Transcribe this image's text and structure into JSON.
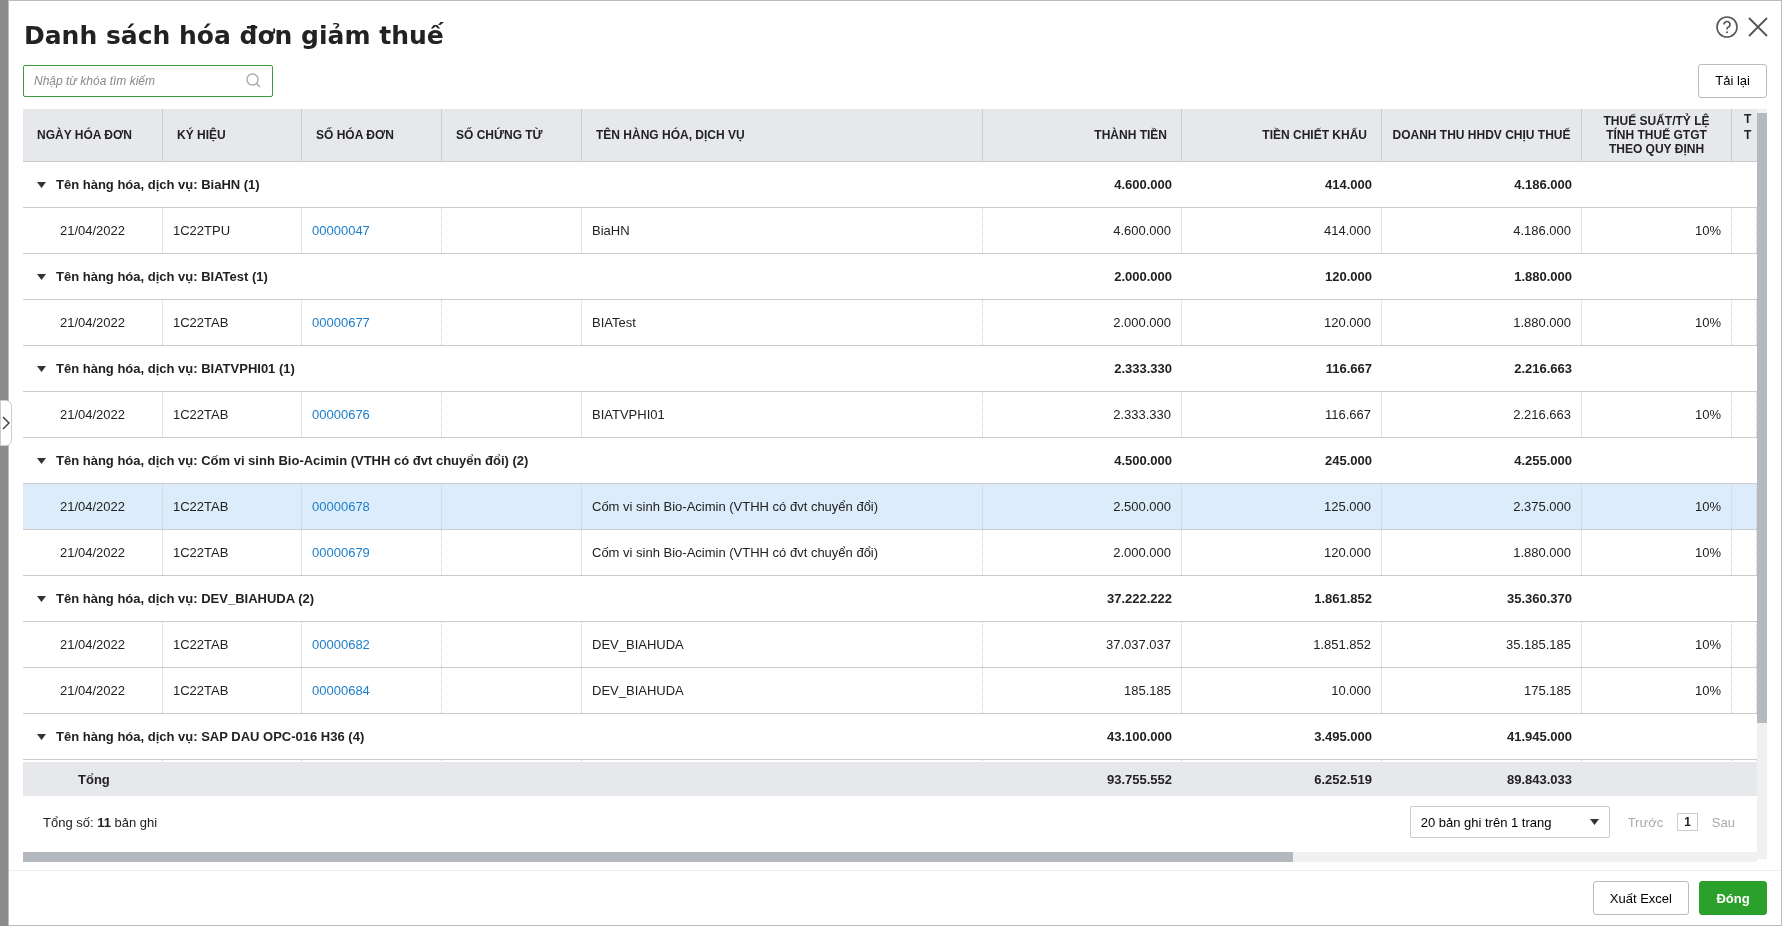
{
  "dialog": {
    "title": "Danh sách hóa đơn giảm thuế"
  },
  "search": {
    "placeholder": "Nhập từ khóa tìm kiếm"
  },
  "reload_button": "Tải lại",
  "table": {
    "columns": [
      "NGÀY HÓA ĐƠN",
      "KÝ HIỆU",
      "SỐ HÓA ĐƠN",
      "SỐ CHỨNG TỪ",
      "TÊN HÀNG HÓA, DỊCH VỤ",
      "THÀNH TIỀN",
      "TIỀN CHIẾT KHẤU",
      "DOANH THU HHDV CHỊU THUẾ",
      "THUẾ SUẤT/TỶ LỆ TÍNH THUẾ GTGT THEO QUY ĐỊNH",
      "T T"
    ],
    "groups": [
      {
        "label": "Tên hàng hóa, dịch vụ: BiaHN (1)",
        "expanded": true,
        "amount": "4.600.000",
        "discount": "414.000",
        "revenue": "4.186.000",
        "rows": [
          {
            "date": "21/04/2022",
            "symbol": "1C22TPU",
            "number": "00000047",
            "name": "BiaHN",
            "amount": "4.600.000",
            "discount": "414.000",
            "revenue": "4.186.000",
            "rate": "10%",
            "selected": false
          }
        ]
      },
      {
        "label": "Tên hàng hóa, dịch vụ: BIATest (1)",
        "expanded": true,
        "amount": "2.000.000",
        "discount": "120.000",
        "revenue": "1.880.000",
        "rows": [
          {
            "date": "21/04/2022",
            "symbol": "1C22TAB",
            "number": "00000677",
            "name": "BIATest",
            "amount": "2.000.000",
            "discount": "120.000",
            "revenue": "1.880.000",
            "rate": "10%",
            "selected": false
          }
        ]
      },
      {
        "label": "Tên hàng hóa, dịch vụ: BIATVPHI01 (1)",
        "expanded": true,
        "amount": "2.333.330",
        "discount": "116.667",
        "revenue": "2.216.663",
        "rows": [
          {
            "date": "21/04/2022",
            "symbol": "1C22TAB",
            "number": "00000676",
            "name": "BIATVPHI01",
            "amount": "2.333.330",
            "discount": "116.667",
            "revenue": "2.216.663",
            "rate": "10%",
            "selected": false
          }
        ]
      },
      {
        "label": "Tên hàng hóa, dịch vụ: Cốm vi sinh Bio-Acimin (VTHH có đvt chuyển đổi) (2)",
        "expanded": true,
        "amount": "4.500.000",
        "discount": "245.000",
        "revenue": "4.255.000",
        "rows": [
          {
            "date": "21/04/2022",
            "symbol": "1C22TAB",
            "number": "00000678",
            "name": "Cốm vi sinh Bio-Acimin (VTHH có đvt chuyển đổi)",
            "amount": "2.500.000",
            "discount": "125.000",
            "revenue": "2.375.000",
            "rate": "10%",
            "selected": true
          },
          {
            "date": "21/04/2022",
            "symbol": "1C22TAB",
            "number": "00000679",
            "name": "Cốm vi sinh Bio-Acimin (VTHH có đvt chuyển đổi)",
            "amount": "2.000.000",
            "discount": "120.000",
            "revenue": "1.880.000",
            "rate": "10%",
            "selected": false
          }
        ]
      },
      {
        "label": "Tên hàng hóa, dịch vụ: DEV_BIAHUDA (2)",
        "expanded": true,
        "amount": "37.222.222",
        "discount": "1.861.852",
        "revenue": "35.360.370",
        "rows": [
          {
            "date": "21/04/2022",
            "symbol": "1C22TAB",
            "number": "00000682",
            "name": "DEV_BIAHUDA",
            "amount": "37.037.037",
            "discount": "1.851.852",
            "revenue": "35.185.185",
            "rate": "10%",
            "selected": false
          },
          {
            "date": "21/04/2022",
            "symbol": "1C22TAB",
            "number": "00000684",
            "name": "DEV_BIAHUDA",
            "amount": "185.185",
            "discount": "10.000",
            "revenue": "175.185",
            "rate": "10%",
            "selected": false
          }
        ]
      },
      {
        "label": "Tên hàng hóa, dịch vụ: SAP DAU OPC-016 H36 (4)",
        "expanded": true,
        "amount": "43.100.000",
        "discount": "3.495.000",
        "revenue": "41.945.000"
      }
    ],
    "total": {
      "label": "Tổng",
      "amount": "93.755.552",
      "discount": "6.252.519",
      "revenue": "89.843.033"
    }
  },
  "pager": {
    "summary": "Tổng số: **11** bản ghi",
    "page_size": "20 bản ghi trên 1 trang",
    "prev": "Trước",
    "page": "1",
    "next": "Sau",
    "prev_disabled": true,
    "next_disabled": true
  },
  "buttons": {
    "export": "Xuất Excel",
    "close": "Đóng"
  }
}
